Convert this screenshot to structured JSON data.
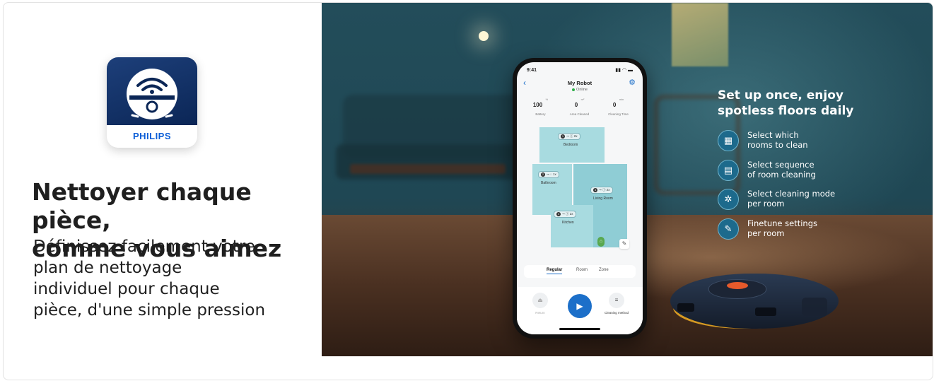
{
  "app_icon": {
    "brand": "PHILIPS",
    "icon": "robot-vacuum-wifi-icon"
  },
  "headline": {
    "line1": "Nettoyer chaque pièce,",
    "line2": "comme vous aimez"
  },
  "subline": {
    "line1": "Définissez facilement votre",
    "line2": "plan de nettoyage",
    "line3": "individuel pour chaque",
    "line4": "pièce, d'une simple pression"
  },
  "phone": {
    "status_time": "9:41",
    "title": "My Robot",
    "status": "Online",
    "stats": [
      {
        "value": "100",
        "unit": "%",
        "label": "Battery"
      },
      {
        "value": "0",
        "unit": "m²",
        "label": "Area Cleaned"
      },
      {
        "value": "0",
        "unit": "min",
        "label": "Cleaning Time"
      }
    ],
    "rooms": [
      {
        "num": "1",
        "chip": "⊸ ⓘ 2x",
        "name": "Bedroom"
      },
      {
        "num": "2",
        "chip": "⊸ ◌ 1x",
        "name": "Bathroom"
      },
      {
        "num": "3",
        "chip": "⊸ ⓘ 2x",
        "name": "Living Room"
      },
      {
        "num": "4",
        "chip": "⊸ ⓘ 2x",
        "name": "Kitchen"
      }
    ],
    "tabs": [
      "Regular",
      "Room",
      "Zone"
    ],
    "return_label": "Return",
    "method_label": "Cleaning method"
  },
  "features": {
    "title_line1": "Set up once, enjoy",
    "title_line2": "spotless floors daily",
    "items": [
      {
        "icon": "room-select-icon",
        "line1": "Select which",
        "line2": "rooms to clean"
      },
      {
        "icon": "sequence-icon",
        "line1": "Select sequence",
        "line2": "of room cleaning"
      },
      {
        "icon": "cleaning-mode-icon",
        "line1": "Select cleaning mode",
        "line2": "per room"
      },
      {
        "icon": "pencil-icon",
        "line1": "Finetune settings",
        "line2": "per room"
      }
    ]
  },
  "colors": {
    "accent": "#1c6fc9",
    "brand": "#0b5ed7",
    "text": "#1f1f1f"
  }
}
